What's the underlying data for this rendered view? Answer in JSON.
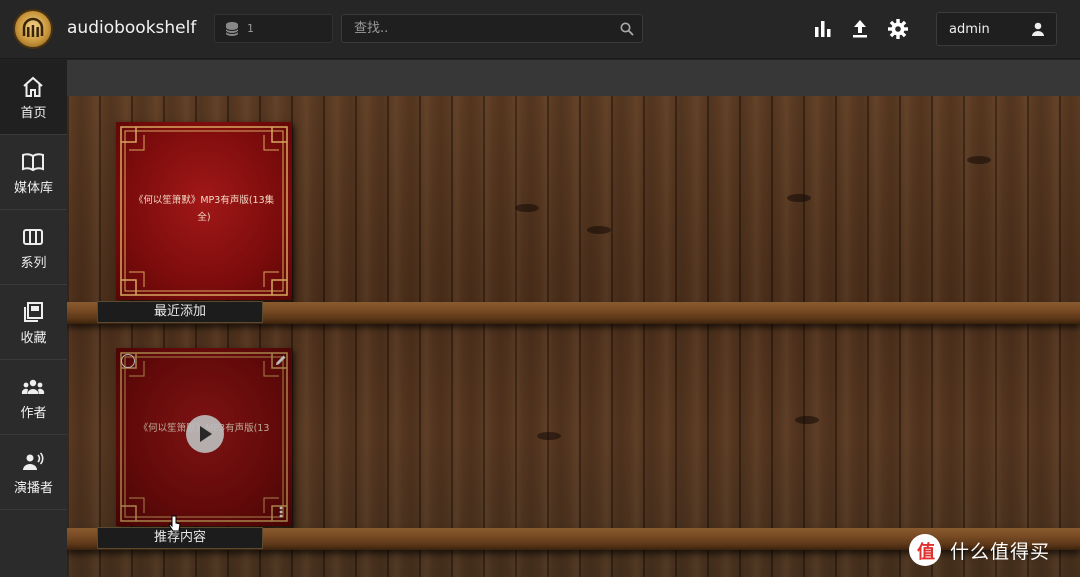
{
  "header": {
    "app_title": "audiobookshelf",
    "library_count": "1",
    "search_placeholder": "查找..",
    "username": "admin",
    "icons": [
      "stats-icon",
      "upload-icon",
      "settings-icon",
      "user-icon"
    ]
  },
  "sidebar": {
    "items": [
      {
        "label": "首页",
        "icon": "home-icon",
        "active": true
      },
      {
        "label": "媒体库",
        "icon": "book-open-icon",
        "active": false
      },
      {
        "label": "系列",
        "icon": "columns-icon",
        "active": false
      },
      {
        "label": "收藏",
        "icon": "collections-icon",
        "active": false
      },
      {
        "label": "作者",
        "icon": "people-icon",
        "active": false
      },
      {
        "label": "演播者",
        "icon": "narrator-icon",
        "active": false
      }
    ]
  },
  "shelves": [
    {
      "label": "最近添加",
      "book_title": "《何以笙箫默》MP3有声版(13集全)"
    },
    {
      "label": "推荐内容",
      "book_title": "《何以笙箫默》MP3有声版(13"
    }
  ],
  "watermark": {
    "text": "什么值得买",
    "logo_glyph": "值"
  },
  "colors": {
    "accent_gold": "#c9963c",
    "cover_red": "#8b1010",
    "frame_gold": "#d8a860"
  }
}
